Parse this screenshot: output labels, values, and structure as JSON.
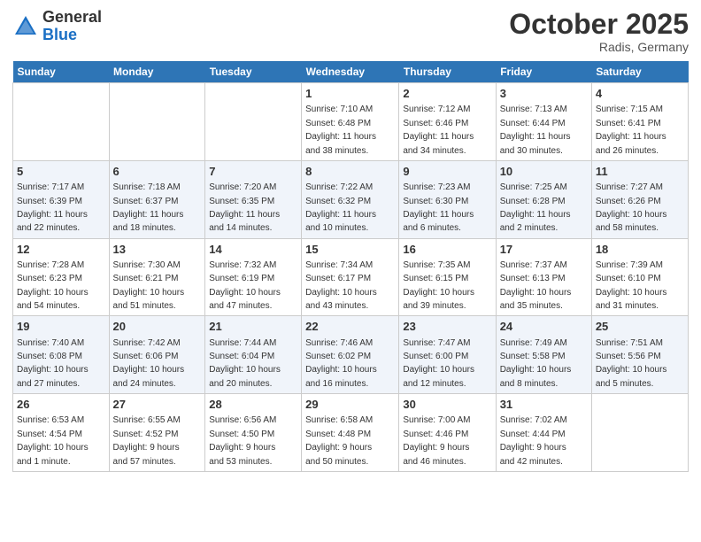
{
  "logo": {
    "general": "General",
    "blue": "Blue"
  },
  "title": "October 2025",
  "subtitle": "Radis, Germany",
  "weekdays": [
    "Sunday",
    "Monday",
    "Tuesday",
    "Wednesday",
    "Thursday",
    "Friday",
    "Saturday"
  ],
  "weeks": [
    [
      {
        "day": "",
        "info": ""
      },
      {
        "day": "",
        "info": ""
      },
      {
        "day": "",
        "info": ""
      },
      {
        "day": "1",
        "info": "Sunrise: 7:10 AM\nSunset: 6:48 PM\nDaylight: 11 hours\nand 38 minutes."
      },
      {
        "day": "2",
        "info": "Sunrise: 7:12 AM\nSunset: 6:46 PM\nDaylight: 11 hours\nand 34 minutes."
      },
      {
        "day": "3",
        "info": "Sunrise: 7:13 AM\nSunset: 6:44 PM\nDaylight: 11 hours\nand 30 minutes."
      },
      {
        "day": "4",
        "info": "Sunrise: 7:15 AM\nSunset: 6:41 PM\nDaylight: 11 hours\nand 26 minutes."
      }
    ],
    [
      {
        "day": "5",
        "info": "Sunrise: 7:17 AM\nSunset: 6:39 PM\nDaylight: 11 hours\nand 22 minutes."
      },
      {
        "day": "6",
        "info": "Sunrise: 7:18 AM\nSunset: 6:37 PM\nDaylight: 11 hours\nand 18 minutes."
      },
      {
        "day": "7",
        "info": "Sunrise: 7:20 AM\nSunset: 6:35 PM\nDaylight: 11 hours\nand 14 minutes."
      },
      {
        "day": "8",
        "info": "Sunrise: 7:22 AM\nSunset: 6:32 PM\nDaylight: 11 hours\nand 10 minutes."
      },
      {
        "day": "9",
        "info": "Sunrise: 7:23 AM\nSunset: 6:30 PM\nDaylight: 11 hours\nand 6 minutes."
      },
      {
        "day": "10",
        "info": "Sunrise: 7:25 AM\nSunset: 6:28 PM\nDaylight: 11 hours\nand 2 minutes."
      },
      {
        "day": "11",
        "info": "Sunrise: 7:27 AM\nSunset: 6:26 PM\nDaylight: 10 hours\nand 58 minutes."
      }
    ],
    [
      {
        "day": "12",
        "info": "Sunrise: 7:28 AM\nSunset: 6:23 PM\nDaylight: 10 hours\nand 54 minutes."
      },
      {
        "day": "13",
        "info": "Sunrise: 7:30 AM\nSunset: 6:21 PM\nDaylight: 10 hours\nand 51 minutes."
      },
      {
        "day": "14",
        "info": "Sunrise: 7:32 AM\nSunset: 6:19 PM\nDaylight: 10 hours\nand 47 minutes."
      },
      {
        "day": "15",
        "info": "Sunrise: 7:34 AM\nSunset: 6:17 PM\nDaylight: 10 hours\nand 43 minutes."
      },
      {
        "day": "16",
        "info": "Sunrise: 7:35 AM\nSunset: 6:15 PM\nDaylight: 10 hours\nand 39 minutes."
      },
      {
        "day": "17",
        "info": "Sunrise: 7:37 AM\nSunset: 6:13 PM\nDaylight: 10 hours\nand 35 minutes."
      },
      {
        "day": "18",
        "info": "Sunrise: 7:39 AM\nSunset: 6:10 PM\nDaylight: 10 hours\nand 31 minutes."
      }
    ],
    [
      {
        "day": "19",
        "info": "Sunrise: 7:40 AM\nSunset: 6:08 PM\nDaylight: 10 hours\nand 27 minutes."
      },
      {
        "day": "20",
        "info": "Sunrise: 7:42 AM\nSunset: 6:06 PM\nDaylight: 10 hours\nand 24 minutes."
      },
      {
        "day": "21",
        "info": "Sunrise: 7:44 AM\nSunset: 6:04 PM\nDaylight: 10 hours\nand 20 minutes."
      },
      {
        "day": "22",
        "info": "Sunrise: 7:46 AM\nSunset: 6:02 PM\nDaylight: 10 hours\nand 16 minutes."
      },
      {
        "day": "23",
        "info": "Sunrise: 7:47 AM\nSunset: 6:00 PM\nDaylight: 10 hours\nand 12 minutes."
      },
      {
        "day": "24",
        "info": "Sunrise: 7:49 AM\nSunset: 5:58 PM\nDaylight: 10 hours\nand 8 minutes."
      },
      {
        "day": "25",
        "info": "Sunrise: 7:51 AM\nSunset: 5:56 PM\nDaylight: 10 hours\nand 5 minutes."
      }
    ],
    [
      {
        "day": "26",
        "info": "Sunrise: 6:53 AM\nSunset: 4:54 PM\nDaylight: 10 hours\nand 1 minute."
      },
      {
        "day": "27",
        "info": "Sunrise: 6:55 AM\nSunset: 4:52 PM\nDaylight: 9 hours\nand 57 minutes."
      },
      {
        "day": "28",
        "info": "Sunrise: 6:56 AM\nSunset: 4:50 PM\nDaylight: 9 hours\nand 53 minutes."
      },
      {
        "day": "29",
        "info": "Sunrise: 6:58 AM\nSunset: 4:48 PM\nDaylight: 9 hours\nand 50 minutes."
      },
      {
        "day": "30",
        "info": "Sunrise: 7:00 AM\nSunset: 4:46 PM\nDaylight: 9 hours\nand 46 minutes."
      },
      {
        "day": "31",
        "info": "Sunrise: 7:02 AM\nSunset: 4:44 PM\nDaylight: 9 hours\nand 42 minutes."
      },
      {
        "day": "",
        "info": ""
      }
    ]
  ]
}
